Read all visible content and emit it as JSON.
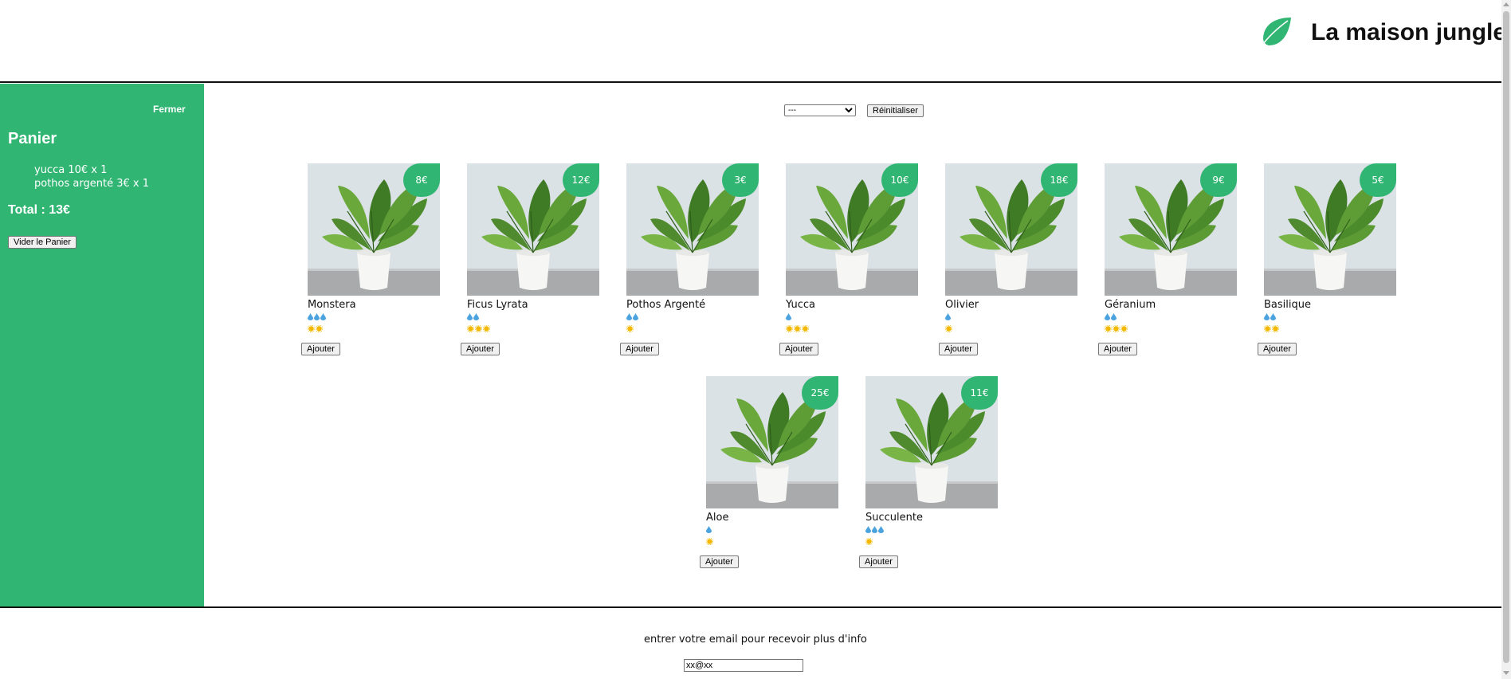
{
  "banner": {
    "title": "La maison jungle",
    "logo_icon": "leaf-icon"
  },
  "cart": {
    "close_label": "Fermer",
    "title": "Panier",
    "items": [
      "yucca 10€ x 1",
      "pothos argenté 3€ x 1"
    ],
    "total": "Total : 13€",
    "empty_label": "Vider le Panier"
  },
  "filter": {
    "selected": "---",
    "reset_label": "Réinitialiser"
  },
  "plants": [
    {
      "name": "Monstera",
      "price": "8€",
      "water": 3,
      "light": 2,
      "add_label": "Ajouter"
    },
    {
      "name": "Ficus Lyrata",
      "price": "12€",
      "water": 2,
      "light": 3,
      "add_label": "Ajouter"
    },
    {
      "name": "Pothos Argenté",
      "price": "3€",
      "water": 2,
      "light": 1,
      "add_label": "Ajouter"
    },
    {
      "name": "Yucca",
      "price": "10€",
      "water": 1,
      "light": 3,
      "add_label": "Ajouter"
    },
    {
      "name": "Olivier",
      "price": "18€",
      "water": 1,
      "light": 1,
      "add_label": "Ajouter"
    },
    {
      "name": "Géranium",
      "price": "9€",
      "water": 2,
      "light": 3,
      "add_label": "Ajouter"
    },
    {
      "name": "Basilique",
      "price": "5€",
      "water": 2,
      "light": 2,
      "add_label": "Ajouter"
    },
    {
      "name": "Aloe",
      "price": "25€",
      "water": 1,
      "light": 1,
      "add_label": "Ajouter"
    },
    {
      "name": "Succulente",
      "price": "11€",
      "water": 3,
      "light": 1,
      "add_label": "Ajouter"
    }
  ],
  "footer": {
    "text": "entrer votre email pour recevoir plus d'info",
    "email_value": "xx@xx"
  },
  "colors": {
    "brand": "#31b572",
    "water": "#4aa3df",
    "sun": "#f5b800"
  }
}
